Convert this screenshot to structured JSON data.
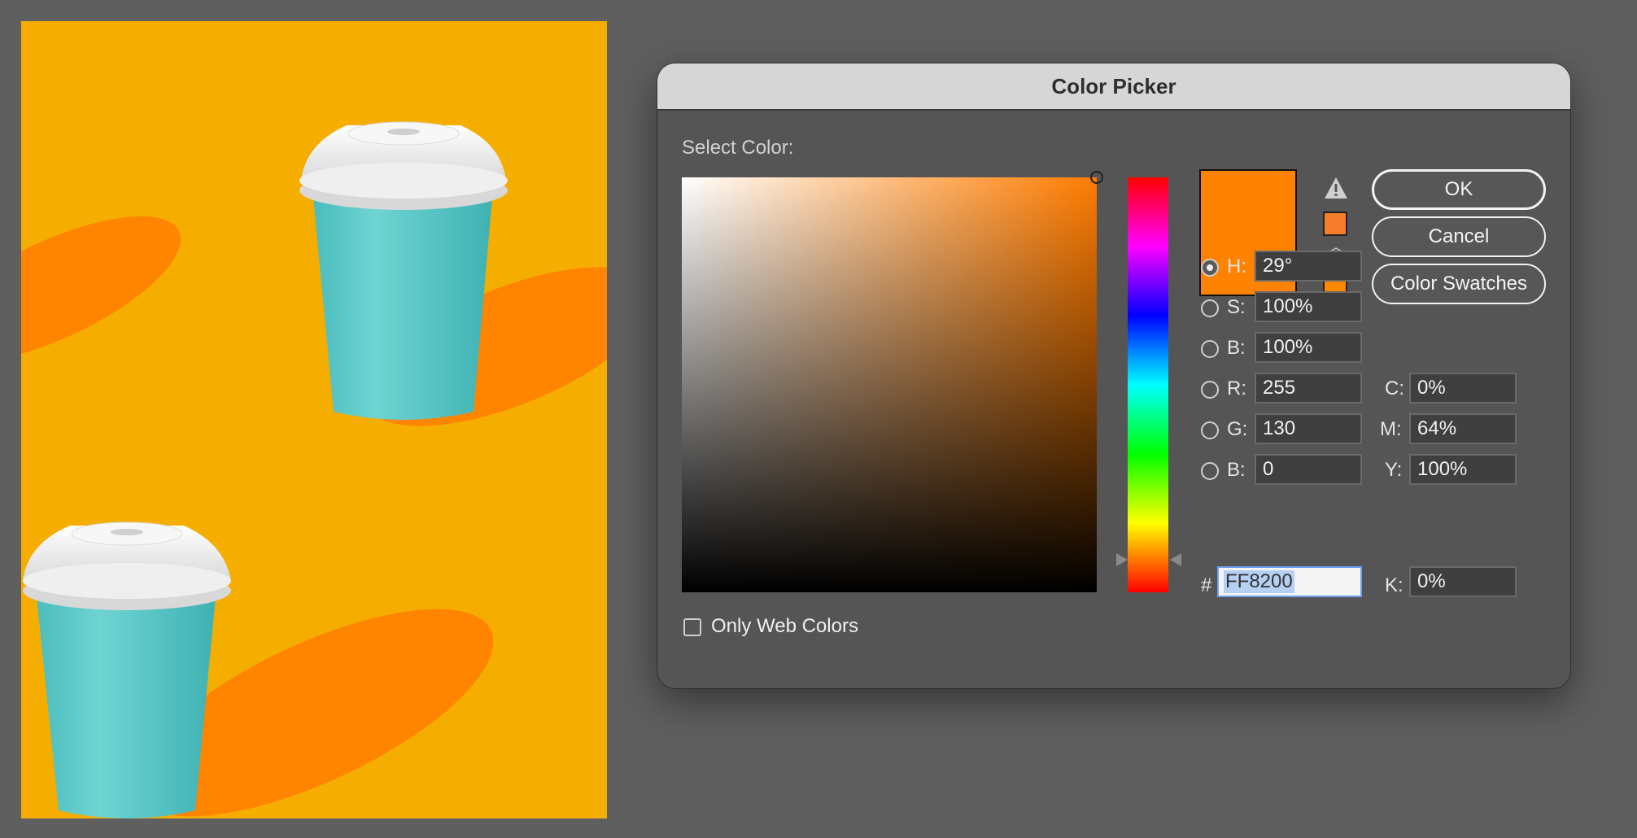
{
  "dialog": {
    "title": "Color Picker",
    "select_label": "Select Color:",
    "buttons": {
      "ok": "OK",
      "cancel": "Cancel",
      "swatches": "Color Swatches"
    },
    "hsb": [
      {
        "key": "H:",
        "value": "29°",
        "checked": true
      },
      {
        "key": "S:",
        "value": "100%",
        "checked": false
      },
      {
        "key": "B:",
        "value": "100%",
        "checked": false
      }
    ],
    "rgb": [
      {
        "key": "R:",
        "value": "255",
        "checked": false
      },
      {
        "key": "G:",
        "value": "130",
        "checked": false
      },
      {
        "key": "B:",
        "value": "0",
        "checked": false
      }
    ],
    "cmyk": [
      {
        "key": "C:",
        "value": "0%"
      },
      {
        "key": "M:",
        "value": "64%"
      },
      {
        "key": "Y:",
        "value": "100%"
      },
      {
        "key": "K:",
        "value": "0%"
      }
    ],
    "hex_label": "#",
    "hex_value": "FF8200",
    "web_only_label": "Only Web Colors",
    "web_only_checked": false
  },
  "colors": {
    "selected": "#ff8200",
    "hue_base": "#ff7c00",
    "gamut_swatch": "#f57d2b",
    "web_swatch": "#ff8800",
    "artboard_bg": "#f5ae00",
    "cup_shadow": "#ff8400",
    "cup_body": "#5dcccc",
    "cup_lid": "#f2f2f2"
  },
  "icons": {
    "gamut_warning": "warning-triangle-icon",
    "web_warning": "cube-icon"
  }
}
